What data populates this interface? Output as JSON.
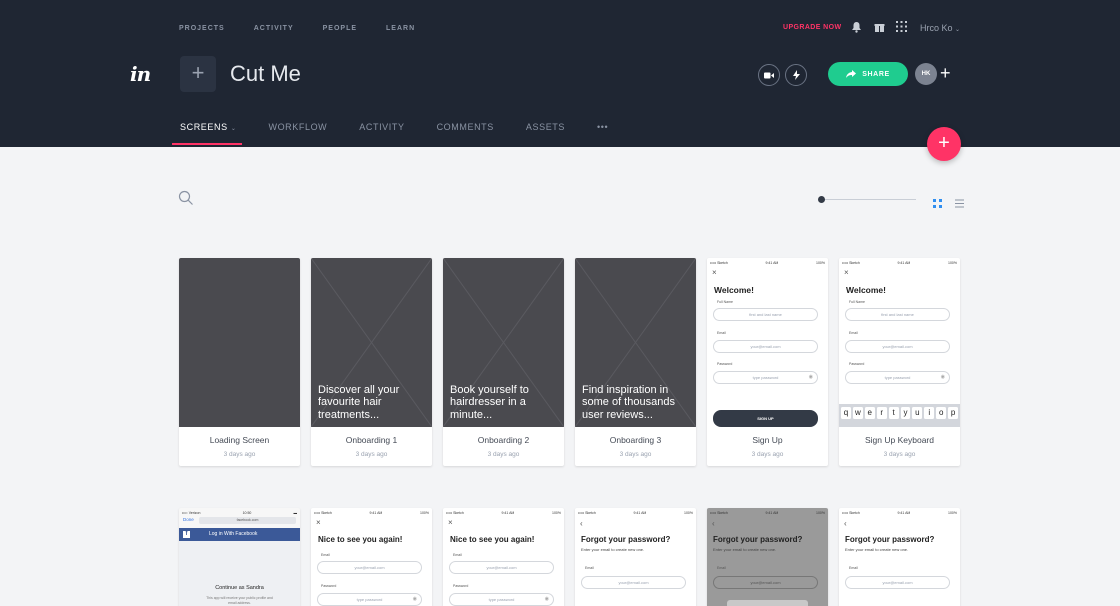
{
  "topnav": {
    "projects": "PROJECTS",
    "activity": "ACTIVITY",
    "people": "PEOPLE",
    "learn": "LEARN",
    "upgrade": "UPGRADE NOW",
    "user": "Hrco Ko"
  },
  "header": {
    "logo": "in",
    "add_icon": "+",
    "project_title": "Cut Me",
    "share": "SHARE",
    "avatar": "HK",
    "add_member": "+"
  },
  "tabs": [
    {
      "label": "SCREENS"
    },
    {
      "label": "WORKFLOW"
    },
    {
      "label": "ACTIVITY"
    },
    {
      "label": "COMMENTS"
    },
    {
      "label": "ASSETS"
    },
    {
      "label": "•••"
    }
  ],
  "fab": "+",
  "toolbar": {
    "zoom_level": 0.0,
    "view": "grid"
  },
  "colors": {
    "header_bg": "#1f2633",
    "accent": "#ff3366",
    "share": "#1fcc8f"
  },
  "cards": [
    {
      "name": "Loading Screen",
      "date": "3 days ago"
    },
    {
      "name": "Onboarding 1",
      "date": "3 days ago",
      "text": "Discover all your favourite hair treatments..."
    },
    {
      "name": "Onboarding 2",
      "date": "3 days ago",
      "text": "Book yourself to hairdresser in a minute..."
    },
    {
      "name": "Onboarding 3",
      "date": "3 days ago",
      "text": "Find inspiration in some of thousands user reviews..."
    },
    {
      "name": "Sign Up",
      "date": "3 days ago"
    },
    {
      "name": "Sign Up Keyboard",
      "date": "3 days ago"
    }
  ],
  "signup": {
    "carrier": "••••• Sketch",
    "time": "9:41 AM",
    "battery": "100%",
    "close": "×",
    "title": "Welcome!",
    "fullname_label": "Full Name",
    "fullname_ph": "first and last name",
    "email_label": "Email",
    "email_ph": "your@email.com",
    "password_label": "Password",
    "password_ph": "type password",
    "button": "SIGN UP",
    "keys": [
      "q",
      "w",
      "e",
      "r",
      "t",
      "y",
      "u",
      "i",
      "o",
      "p"
    ]
  },
  "row2": {
    "fb": {
      "carrier": "•••○ Verizon",
      "time": "10:50",
      "done": "Done",
      "url": "facebook.com",
      "login": "Log in With Facebook",
      "continue": "Continue as Sandra",
      "note": "This app will receive your public profile and email address."
    },
    "login": {
      "title": "Nice to see you again!",
      "email_label": "Email",
      "email_ph": "your@email.com",
      "password_label": "Password",
      "password_ph": "type password"
    },
    "forgot": {
      "title": "Forgot your password?",
      "sub": "Enter your email to create new one.",
      "email_label": "Email",
      "email_ph": "your@email.com"
    }
  }
}
